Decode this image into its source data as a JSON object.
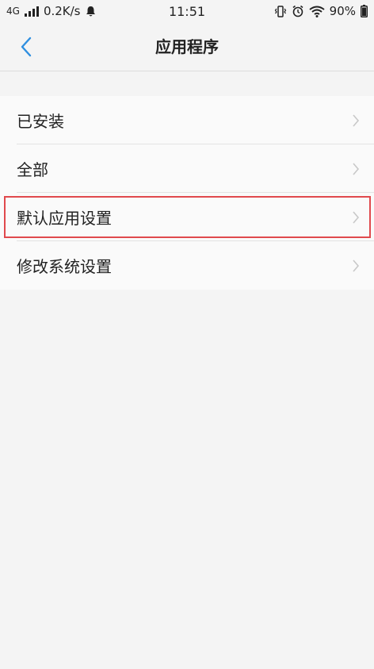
{
  "status_bar": {
    "network_type": "4G",
    "speed": "0.2K/s",
    "time": "11:51",
    "battery": "90%",
    "icons": [
      "signal-icon",
      "notification-icon",
      "vibrate-icon",
      "alarm-icon",
      "wifi-icon",
      "battery-icon"
    ]
  },
  "header": {
    "title": "应用程序",
    "back_icon": "chevron-left-icon",
    "accent_color": "#2f8fe0"
  },
  "menu": {
    "highlight_color": "#e0494d",
    "items": [
      {
        "label": "已安装"
      },
      {
        "label": "全部"
      },
      {
        "label": "默认应用设置",
        "highlighted": true
      },
      {
        "label": "修改系统设置"
      }
    ]
  }
}
